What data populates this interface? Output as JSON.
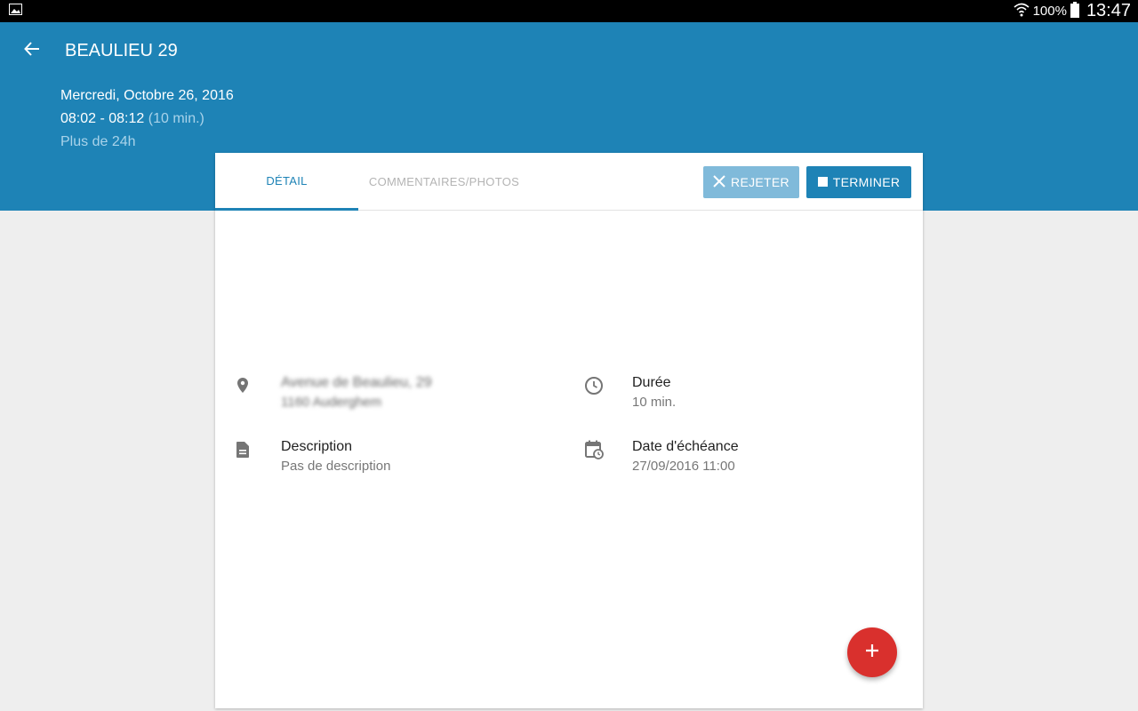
{
  "status_bar": {
    "battery": "100%",
    "time": "13:47"
  },
  "header": {
    "title": "BEAULIEU 29",
    "date": "Mercredi, Octobre 26, 2016",
    "time_range": "08:02 - 08:12",
    "duration_note": "(10 min.)",
    "age": "Plus de 24h"
  },
  "tabs": [
    {
      "label": "DÉTAIL",
      "active": true
    },
    {
      "label": "COMMENTAIRES/PHOTOS",
      "active": false
    }
  ],
  "actions": {
    "reject_label": "REJETER",
    "finish_label": "TERMINER"
  },
  "details": {
    "address_line1": "Avenue de Beaulieu, 29",
    "address_line2": "1160 Auderghem",
    "duration_label": "Durée",
    "duration_value": "10 min.",
    "description_label": "Description",
    "description_value": "Pas de description",
    "due_label": "Date d'échéance",
    "due_value": "27/09/2016 11:00"
  },
  "colors": {
    "primary": "#1e83b6",
    "reject_button": "#80bada",
    "fab": "#d9302d",
    "background": "#eeeeee"
  },
  "icons": [
    "image-icon",
    "wifi-icon",
    "battery-icon",
    "back-arrow-icon",
    "close-icon",
    "stop-icon",
    "location-pin-icon",
    "clock-icon",
    "description-icon",
    "calendar-clock-icon",
    "plus-icon"
  ]
}
